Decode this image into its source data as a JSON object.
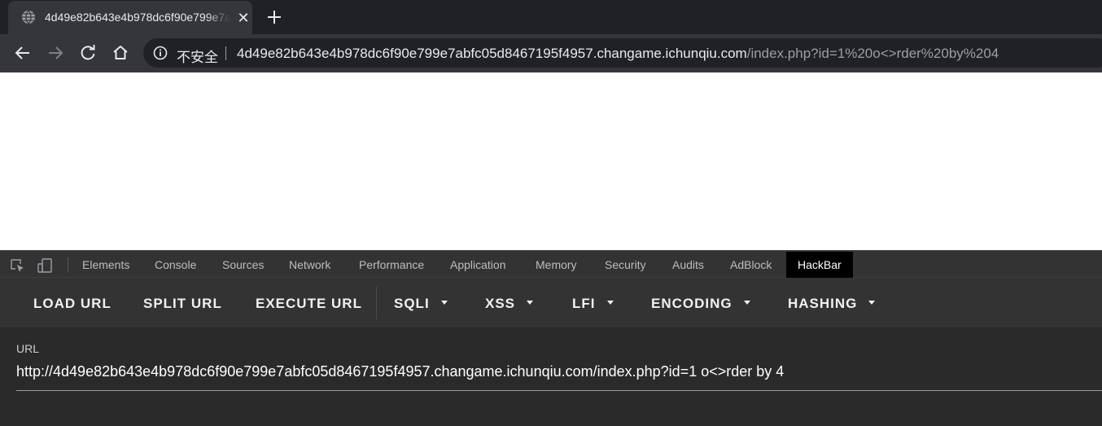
{
  "tab": {
    "title": "4d49e82b643e4b978dc6f90e799e7abfc05d8467195f4957",
    "close_glyph": "✕",
    "favicon": "globe-icon"
  },
  "omnibox": {
    "security_label": "不安全",
    "host": "4d49e82b643e4b978dc6f90e799e7abfc05d8467195f4957.changame.ichunqiu.com",
    "path": "/index.php?id=1%20o<>rder%20by%204"
  },
  "devtools": {
    "tabs": [
      "Elements",
      "Console",
      "Sources",
      "Network",
      "Performance",
      "Application",
      "Memory",
      "Security",
      "Audits",
      "AdBlock",
      "HackBar"
    ],
    "active_tab": "HackBar"
  },
  "hackbar": {
    "buttons": {
      "load_url": "LOAD URL",
      "split_url": "SPLIT URL",
      "execute_url": "EXECUTE URL",
      "sqli": "SQLI",
      "xss": "XSS",
      "lfi": "LFI",
      "encoding": "ENCODING",
      "hashing": "HASHING"
    },
    "url_label": "URL",
    "url_value": "http://4d49e82b643e4b978dc6f90e799e7abfc05d8467195f4957.changame.ichunqiu.com/index.php?id=1 o<>rder by 4"
  }
}
